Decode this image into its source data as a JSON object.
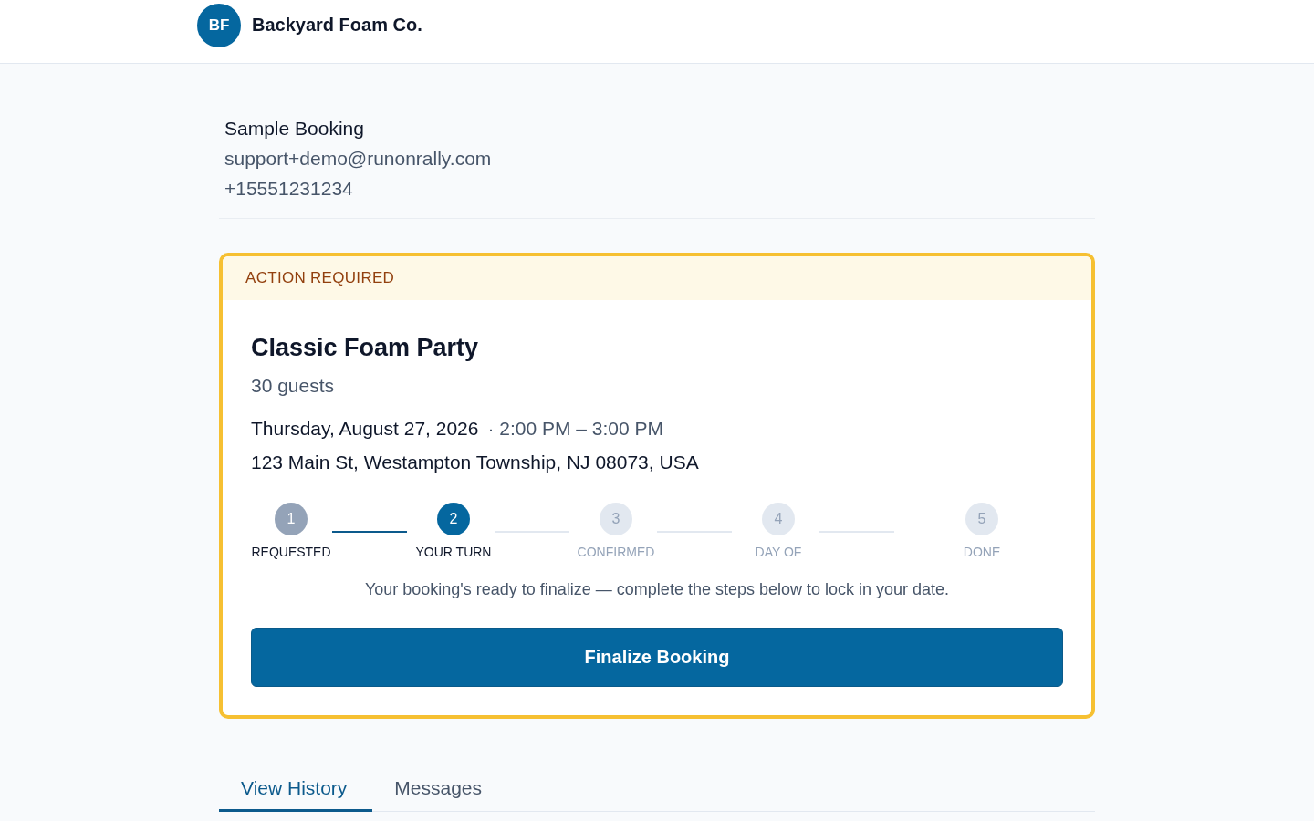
{
  "header": {
    "logo_initials": "BF",
    "business_name": "Backyard Foam Co."
  },
  "customer": {
    "name": "Sample Booking",
    "email": "support+demo@runonrally.com",
    "phone": "+15551231234"
  },
  "booking_card": {
    "banner": "ACTION REQUIRED",
    "title": "Classic Foam Party",
    "guests": "30 guests",
    "date": "Thursday, August 27, 2026",
    "time": "· 2:00 PM – 3:00 PM",
    "address": "123 Main St, Westampton Township, NJ 08073, USA",
    "steps": [
      {
        "number": "1",
        "label": "REQUESTED",
        "completed": true,
        "current": false
      },
      {
        "number": "2",
        "label": "YOUR TURN",
        "completed": false,
        "current": true
      },
      {
        "number": "3",
        "label": "CONFIRMED",
        "completed": false,
        "current": false
      },
      {
        "number": "4",
        "label": "DAY OF",
        "completed": false,
        "current": false
      },
      {
        "number": "5",
        "label": "DONE",
        "completed": false,
        "current": false
      }
    ],
    "note": "Your booking's ready to finalize — complete the steps below to lock in your date.",
    "button": "Finalize Booking"
  },
  "tabs": [
    {
      "label": "View History",
      "selected": true
    },
    {
      "label": "Messages",
      "selected": false
    }
  ]
}
